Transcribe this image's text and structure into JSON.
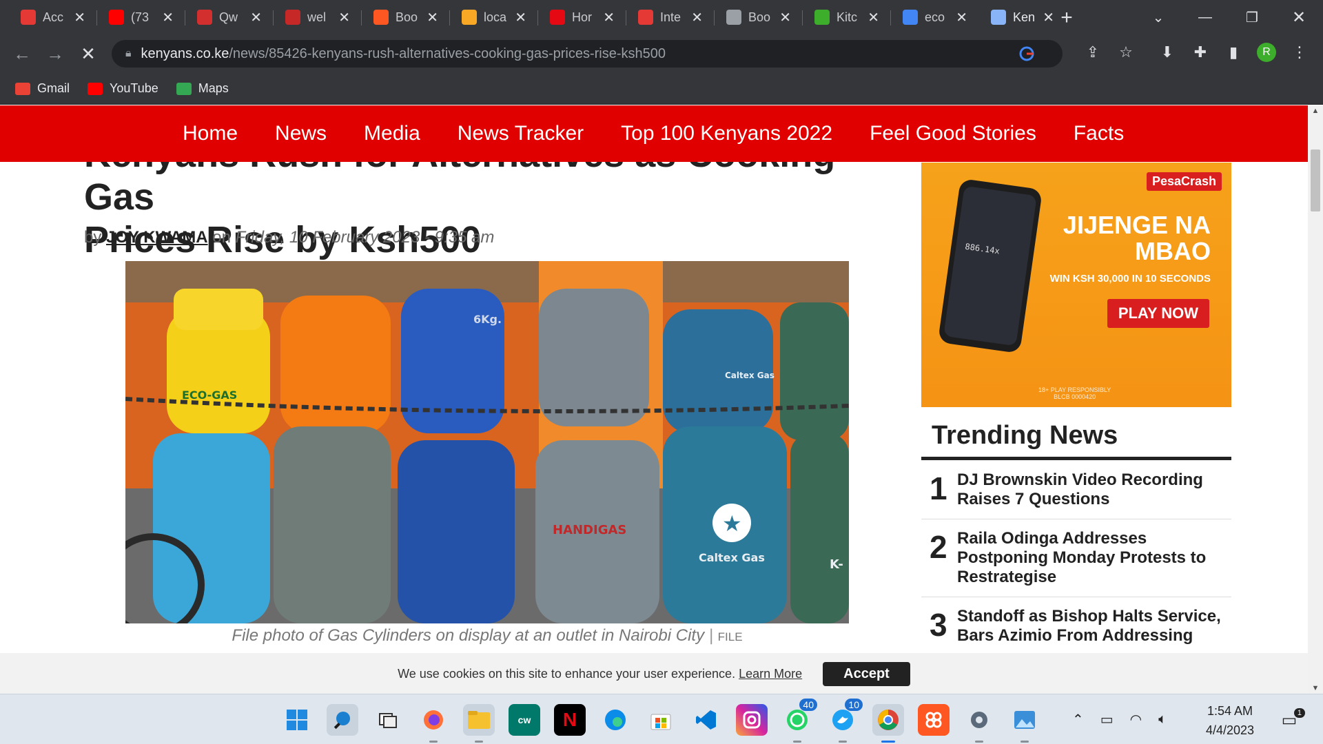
{
  "browser": {
    "tabs": [
      {
        "title": "Acc",
        "icon": "red-square-icon",
        "color": "#e53935"
      },
      {
        "title": "(73",
        "icon": "youtube-icon",
        "color": "#ff0000"
      },
      {
        "title": "Qw",
        "icon": "qwant-icon",
        "color": "#d32f2f"
      },
      {
        "title": "wel",
        "icon": "webmail-icon",
        "color": "#c62828"
      },
      {
        "title": "Boo",
        "icon": "bootstrap-icon",
        "color": "#ff5722"
      },
      {
        "title": "loca",
        "icon": "mountain-icon",
        "color": "#f9a825"
      },
      {
        "title": "Hor",
        "icon": "netflix-icon",
        "color": "#e50914"
      },
      {
        "title": "Inte",
        "icon": "speedometer-icon",
        "color": "#e53935"
      },
      {
        "title": "Boo",
        "icon": "globe-icon",
        "color": "#9aa0a6"
      },
      {
        "title": "Kitc",
        "icon": "jiji-icon",
        "color": "#3dae2b"
      },
      {
        "title": "eco",
        "icon": "google-icon",
        "color": "#4285f4"
      },
      {
        "title": "Ken",
        "icon": "loading-icon",
        "color": "#8ab4f8"
      }
    ],
    "url_host": "kenyans.co.ke",
    "url_path": "/news/85426-kenyans-rush-alternatives-cooking-gas-prices-rise-ksh500",
    "bookmarks": [
      {
        "label": "Gmail",
        "icon": "gmail-icon",
        "color": "#ea4335"
      },
      {
        "label": "YouTube",
        "icon": "youtube-icon",
        "color": "#ff0000"
      },
      {
        "label": "Maps",
        "icon": "maps-icon",
        "color": "#34a853"
      }
    ],
    "profile_initial": "R"
  },
  "site": {
    "nav": [
      "Home",
      "News",
      "Media",
      "News Tracker",
      "Top 100 Kenyans 2022",
      "Feel Good Stories",
      "Facts"
    ],
    "accent": "#e00000"
  },
  "article": {
    "title_line1": "Kenyans Rush for Alternatives as Cooking Gas",
    "title_line2": "Prices Rise by Ksh500",
    "by": "by",
    "author": "JOY KWAMA",
    "on": "on",
    "date": "Friday, 10 February 2023 - 9:35 am",
    "caption": "File photo of Gas Cylinders on display at an outlet in Nairobi City",
    "credit": "FILE",
    "photo_labels": [
      "ECO-GAS",
      "6Kg.",
      "Caltex Gas",
      "HANDIGAS",
      "Caltex Gas",
      "K-"
    ]
  },
  "ad": {
    "brand": "PesaCrash",
    "headline_1": "JIJENGE NA",
    "headline_2": "MBAO",
    "tagline": "WIN KSH 30,000 IN 10 SECONDS",
    "cta": "PLAY NOW",
    "readout": "886.14x",
    "fine_1": "18+ PLAY RESPONSIBLY",
    "fine_2": "BLCB 0000420"
  },
  "trending": {
    "title": "Trending News",
    "items": [
      {
        "num": "1",
        "text": "DJ Brownskin Video Recording Raises 7 Questions"
      },
      {
        "num": "2",
        "text": "Raila Odinga Addresses Postponing Monday Protests to Restrategise"
      },
      {
        "num": "3",
        "text": "Standoff as Bishop Halts Service, Bars Azimio From Addressing"
      }
    ]
  },
  "cookie": {
    "message": "We use cookies on this site to enhance your user experience.",
    "learn_more": "Learn More",
    "accept": "Accept"
  },
  "taskbar": {
    "time": "1:54 AM",
    "date": "4/4/2023",
    "whatsapp_badge": "40",
    "twitter_badge": "10",
    "notifications": "1"
  }
}
